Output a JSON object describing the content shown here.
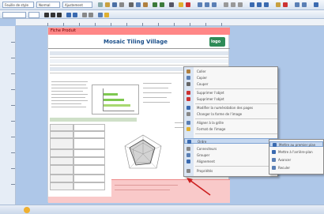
{
  "toolbar": {
    "combo1": "Feuille de style",
    "combo2": "Normal",
    "combo3": "Ajustement",
    "icons": [
      "new-icon",
      "open-icon",
      "save-icon",
      "print-icon",
      "cut-icon",
      "copy-icon",
      "paste-icon",
      "undo-icon",
      "redo-icon",
      "zoom-icon",
      "help-icon"
    ]
  },
  "page": {
    "header_label": "Fiche Produit",
    "title": "Mosaic Tiling Village",
    "logo_text": "logo"
  },
  "context_menu": {
    "items": [
      {
        "label": "Coller",
        "icon": "paste-icon",
        "arrow": ""
      },
      {
        "label": "Copier",
        "icon": "copy-icon",
        "arrow": ""
      },
      {
        "label": "Couper",
        "icon": "cut-icon",
        "arrow": ""
      },
      {
        "label": "Supprimer l'objet",
        "icon": "delete-icon",
        "arrow": ""
      },
      {
        "label": "Supprimer l'objet",
        "icon": "delete-icon",
        "arrow": ""
      },
      {
        "label": "Modifier la numérotation des pages",
        "icon": "numbering-icon",
        "arrow": ""
      },
      {
        "label": "Changer la forme de l'image",
        "icon": "shape-icon",
        "arrow": ""
      },
      {
        "label": "Aligner à la grille",
        "icon": "grid-icon",
        "arrow": ""
      },
      {
        "label": "Format de l'image",
        "icon": "format-icon",
        "arrow": ""
      },
      {
        "label": "Ordre",
        "icon": "order-icon",
        "arrow": "▶"
      },
      {
        "label": "Connecteurs",
        "icon": "connector-icon",
        "arrow": "▶"
      },
      {
        "label": "Grouper",
        "icon": "group-icon",
        "arrow": "▶"
      },
      {
        "label": "Alignement",
        "icon": "align-icon",
        "arrow": "▶"
      },
      {
        "label": "Propriétés",
        "icon": "properties-icon",
        "arrow": ""
      }
    ]
  },
  "submenu": {
    "items": [
      {
        "label": "Mettre au premier plan",
        "icon": "front-icon"
      },
      {
        "label": "Mettre à l'arrière-plan",
        "icon": "back-icon"
      },
      {
        "label": "Avancer",
        "icon": "forward-icon"
      },
      {
        "label": "Reculer",
        "icon": "backward-icon"
      }
    ]
  },
  "colors": {
    "header_strip": "#ff8787",
    "menu_highlight": "#c6d8f0",
    "arrow": "#cc2020"
  }
}
